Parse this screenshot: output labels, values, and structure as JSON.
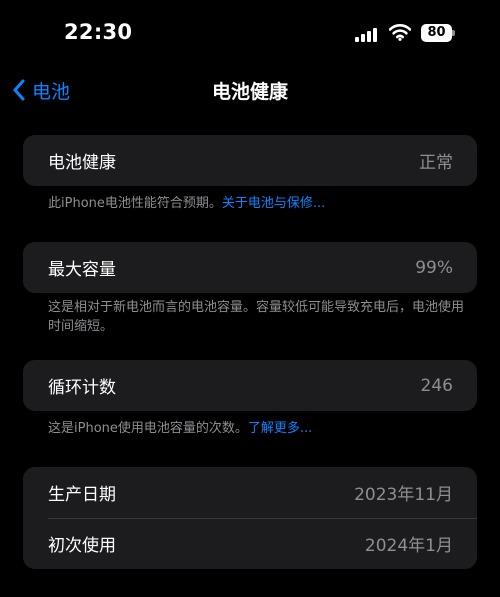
{
  "status_bar": {
    "time": "22:30",
    "battery_level": "80",
    "icons": [
      "signal-icon",
      "wifi-icon",
      "battery-icon"
    ]
  },
  "nav": {
    "back_label": "电池",
    "title": "电池健康"
  },
  "health": {
    "label": "电池健康",
    "value": "正常",
    "footer_text": "此iPhone电池性能符合预期。",
    "footer_link": "关于电池与保修..."
  },
  "capacity": {
    "label": "最大容量",
    "value": "99%",
    "footer_text": "这是相对于新电池而言的电池容量。容量较低可能导致充电后，电池使用时间缩短。"
  },
  "cycles": {
    "label": "循环计数",
    "value": "246",
    "footer_text": "这是iPhone使用电池容量的次数。",
    "footer_link": "了解更多..."
  },
  "dates": {
    "manufacture_label": "生产日期",
    "manufacture_value": "2023年11月",
    "first_use_label": "初次使用",
    "first_use_value": "2024年1月"
  },
  "colors": {
    "background": "#000000",
    "cell": "#1c1c1e",
    "accent": "#0a84ff",
    "secondary_text": "#8e8e93"
  }
}
